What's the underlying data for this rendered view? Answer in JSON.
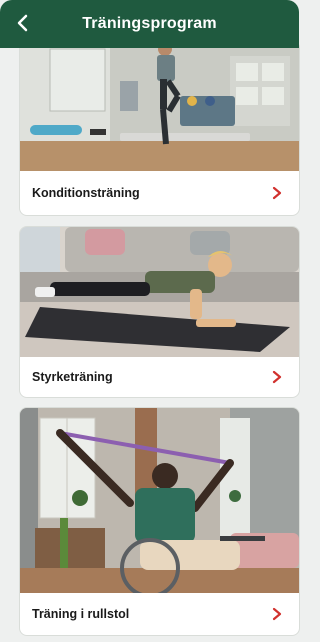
{
  "header": {
    "title": "Träningsprogram",
    "back_icon": "chevron-left-icon"
  },
  "colors": {
    "header_bg": "#1f5a3f",
    "accent_red": "#d1312e",
    "page_bg": "#eef0ef"
  },
  "programs": [
    {
      "label": "Konditionsträning",
      "icon": "chevron-right-icon"
    },
    {
      "label": "Styrketräning",
      "icon": "chevron-right-icon"
    },
    {
      "label": "Träning i rullstol",
      "icon": "chevron-right-icon"
    }
  ]
}
